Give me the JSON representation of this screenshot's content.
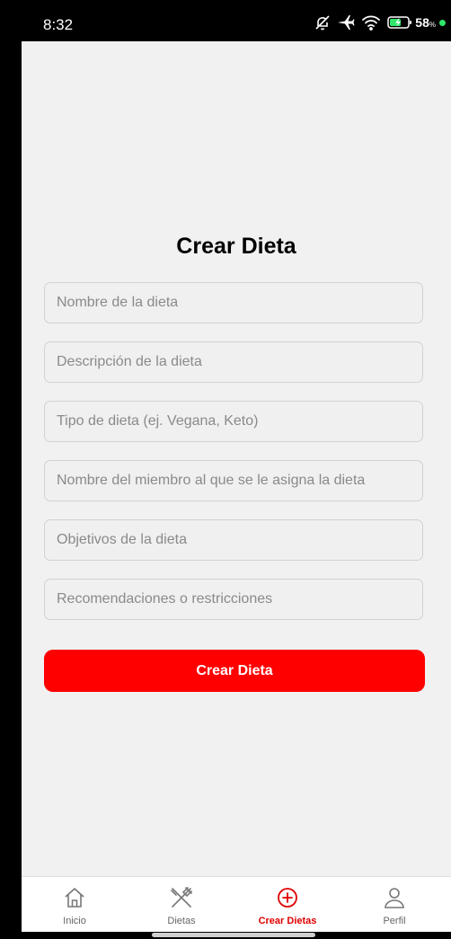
{
  "status_bar": {
    "time": "8:32",
    "battery_percent": "58",
    "battery_unit": "%",
    "icons": [
      "mute-icon",
      "airplane-icon",
      "wifi-icon",
      "battery-icon"
    ]
  },
  "form": {
    "title": "Crear Dieta",
    "fields": [
      {
        "placeholder": "Nombre de la dieta",
        "value": ""
      },
      {
        "placeholder": "Descripción de la dieta",
        "value": ""
      },
      {
        "placeholder": "Tipo de dieta (ej. Vegana, Keto)",
        "value": ""
      },
      {
        "placeholder": "Nombre del miembro al que se le asigna la dieta",
        "value": ""
      },
      {
        "placeholder": "Objetivos de la dieta",
        "value": ""
      },
      {
        "placeholder": "Recomendaciones o restricciones",
        "value": ""
      }
    ],
    "submit_label": "Crear Dieta"
  },
  "nav": {
    "items": [
      {
        "label": "Inicio",
        "icon": "home-icon",
        "active": false
      },
      {
        "label": "Dietas",
        "icon": "utensils-icon",
        "active": false
      },
      {
        "label": "Crear Dietas",
        "icon": "plus-circle-icon",
        "active": true
      },
      {
        "label": "Perfil",
        "icon": "user-icon",
        "active": false
      }
    ]
  },
  "colors": {
    "accent": "#ff0000",
    "background": "#f1f1f1",
    "nav_active": "#e00000",
    "nav_inactive": "#666666"
  }
}
